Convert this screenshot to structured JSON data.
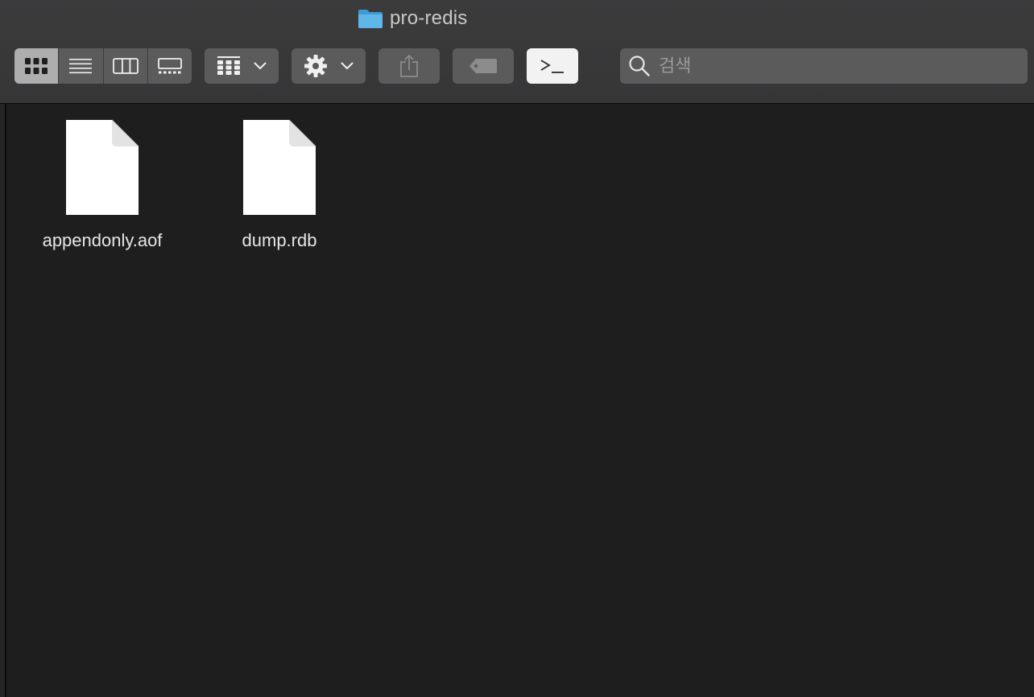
{
  "window": {
    "title": "pro-redis",
    "title_icon": "folder-icon"
  },
  "toolbar": {
    "view_modes": [
      {
        "name": "icon-view",
        "icon": "grid-icon",
        "active": true
      },
      {
        "name": "list-view",
        "icon": "list-icon",
        "active": false
      },
      {
        "name": "column-view",
        "icon": "columns-icon",
        "active": false
      },
      {
        "name": "gallery-view",
        "icon": "gallery-icon",
        "active": false
      }
    ],
    "group_button_icon": "group-grid-icon",
    "action_button_icon": "gear-icon",
    "share_button_icon": "share-icon",
    "tag_button_icon": "tag-icon",
    "terminal_button_label": ">_"
  },
  "search": {
    "placeholder": "검색",
    "value": ""
  },
  "files": [
    {
      "name": "appendonly.aof",
      "icon": "document-icon"
    },
    {
      "name": "dump.rdb",
      "icon": "document-icon"
    }
  ]
}
